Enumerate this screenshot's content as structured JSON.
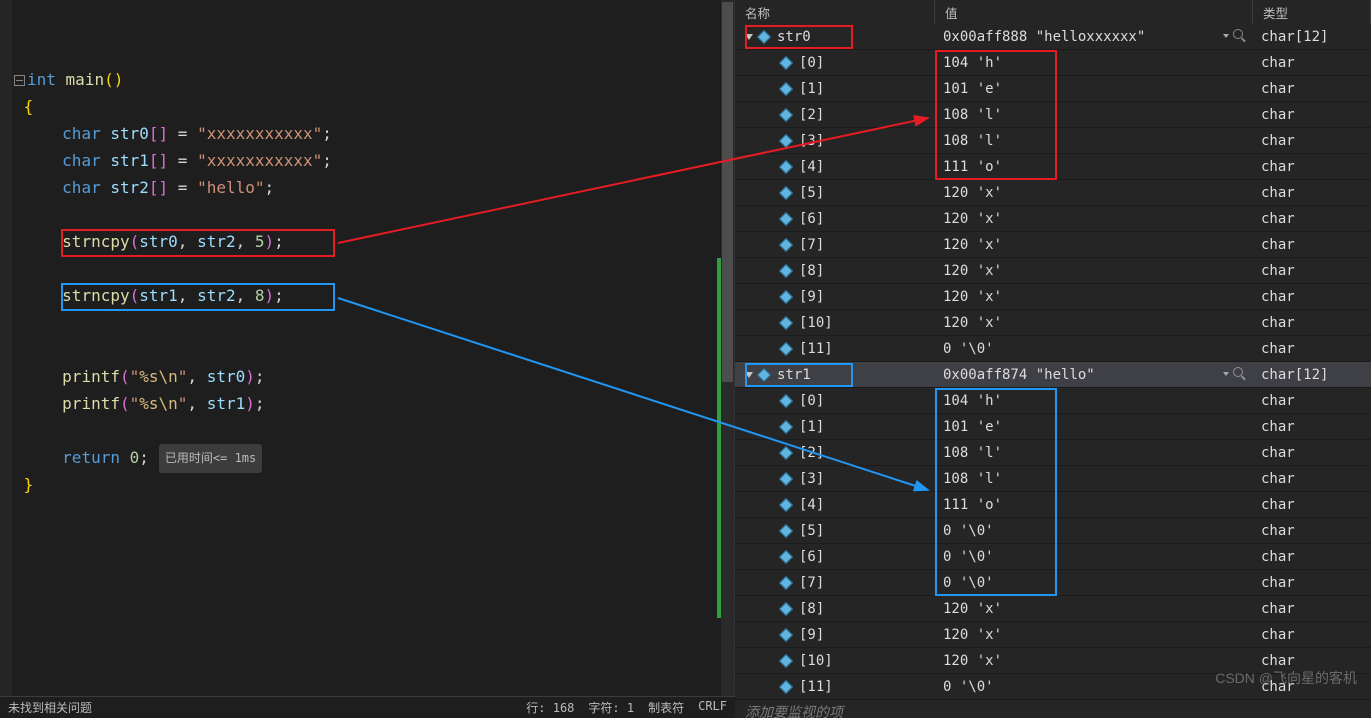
{
  "code": {
    "main_signature": "int main()",
    "decl0": {
      "type": "char",
      "name": "str0",
      "value": "\"xxxxxxxxxxx\""
    },
    "decl1": {
      "type": "char",
      "name": "str1",
      "value": "\"xxxxxxxxxxx\""
    },
    "decl2": {
      "type": "char",
      "name": "str2",
      "value": "\"hello\""
    },
    "call0": {
      "fn": "strncpy",
      "a0": "str0",
      "a1": "str2",
      "a2": "5"
    },
    "call1": {
      "fn": "strncpy",
      "a0": "str1",
      "a1": "str2",
      "a2": "8"
    },
    "printf0": {
      "fn": "printf",
      "fmt": "\"%s\\n\"",
      "arg": "str0"
    },
    "printf1": {
      "fn": "printf",
      "fmt": "\"%s\\n\"",
      "arg": "str1"
    },
    "return": "return 0;",
    "exec_time": "已用时间<= 1ms"
  },
  "status": {
    "left": "未找到相关问题",
    "line": "行: 168",
    "col": "字符: 1",
    "tabs": "制表符",
    "eol": "CRLF"
  },
  "watch": {
    "headers": {
      "name": "名称",
      "value": "值",
      "type": "类型"
    },
    "str0": {
      "name": "str0",
      "value": "0x00aff888 \"helloxxxxxx\"",
      "type": "char[12]",
      "children": [
        {
          "idx": "[0]",
          "val": "104 'h'",
          "type": "char"
        },
        {
          "idx": "[1]",
          "val": "101 'e'",
          "type": "char"
        },
        {
          "idx": "[2]",
          "val": "108 'l'",
          "type": "char"
        },
        {
          "idx": "[3]",
          "val": "108 'l'",
          "type": "char"
        },
        {
          "idx": "[4]",
          "val": "111 'o'",
          "type": "char"
        },
        {
          "idx": "[5]",
          "val": "120 'x'",
          "type": "char"
        },
        {
          "idx": "[6]",
          "val": "120 'x'",
          "type": "char"
        },
        {
          "idx": "[7]",
          "val": "120 'x'",
          "type": "char"
        },
        {
          "idx": "[8]",
          "val": "120 'x'",
          "type": "char"
        },
        {
          "idx": "[9]",
          "val": "120 'x'",
          "type": "char"
        },
        {
          "idx": "[10]",
          "val": "120 'x'",
          "type": "char"
        },
        {
          "idx": "[11]",
          "val": "0 '\\0'",
          "type": "char"
        }
      ]
    },
    "str1": {
      "name": "str1",
      "value": "0x00aff874 \"hello\"",
      "type": "char[12]",
      "children": [
        {
          "idx": "[0]",
          "val": "104 'h'",
          "type": "char"
        },
        {
          "idx": "[1]",
          "val": "101 'e'",
          "type": "char"
        },
        {
          "idx": "[2]",
          "val": "108 'l'",
          "type": "char"
        },
        {
          "idx": "[3]",
          "val": "108 'l'",
          "type": "char"
        },
        {
          "idx": "[4]",
          "val": "111 'o'",
          "type": "char"
        },
        {
          "idx": "[5]",
          "val": "0 '\\0'",
          "type": "char"
        },
        {
          "idx": "[6]",
          "val": "0 '\\0'",
          "type": "char"
        },
        {
          "idx": "[7]",
          "val": "0 '\\0'",
          "type": "char"
        },
        {
          "idx": "[8]",
          "val": "120 'x'",
          "type": "char"
        },
        {
          "idx": "[9]",
          "val": "120 'x'",
          "type": "char"
        },
        {
          "idx": "[10]",
          "val": "120 'x'",
          "type": "char"
        },
        {
          "idx": "[11]",
          "val": "0 '\\0'",
          "type": "char"
        }
      ]
    },
    "add_item": "添加要监视的项"
  },
  "watermark": "CSDN @飞向星的客机"
}
